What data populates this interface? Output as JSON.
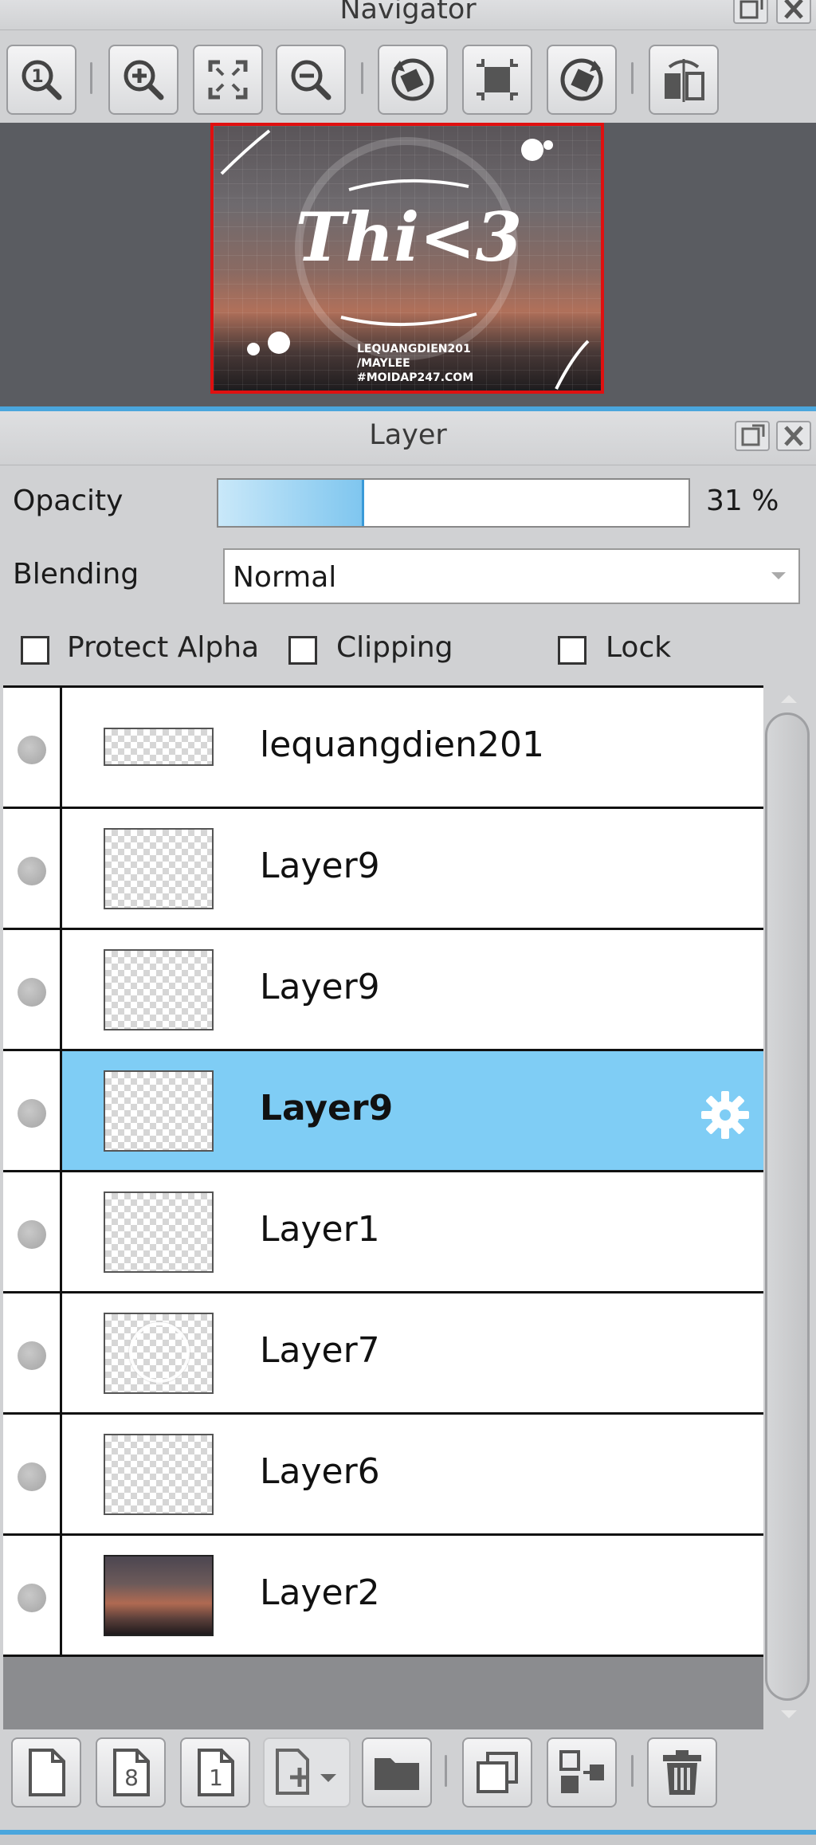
{
  "navigator": {
    "title": "Navigator",
    "toolbar_icons": [
      "zoom-actual-icon",
      "zoom-in-icon",
      "fit-window-icon",
      "zoom-out-icon",
      "rotate-left-icon",
      "rotate-reset-icon",
      "rotate-right-icon",
      "flip-icon"
    ],
    "preview_text": {
      "main": "Thi<3",
      "credits": [
        "LEQUANGDIEN201",
        "/MAYLEE",
        "#MOIDAP247.COM"
      ]
    }
  },
  "layer_panel": {
    "title": "Layer",
    "opacity_label": "Opacity",
    "opacity_value": 31,
    "opacity_text": "31 %",
    "blending_label": "Blending",
    "blending_value": "Normal",
    "checkboxes": [
      {
        "label": "Protect Alpha",
        "checked": false
      },
      {
        "label": "Clipping",
        "checked": false
      },
      {
        "label": "Lock",
        "checked": false
      }
    ],
    "layers": [
      {
        "name": "lequangdien201",
        "selected": false
      },
      {
        "name": "Layer9",
        "selected": false
      },
      {
        "name": "Layer9",
        "selected": false
      },
      {
        "name": "Layer9",
        "selected": true
      },
      {
        "name": "Layer1",
        "selected": false
      },
      {
        "name": "Layer7",
        "selected": false
      },
      {
        "name": "Layer6",
        "selected": false
      },
      {
        "name": "Layer2",
        "selected": false
      }
    ],
    "bottom_icons": [
      "new-layer-icon",
      "new-8bit-layer-icon",
      "new-1bit-layer-icon",
      "add-layer-menu-icon",
      "new-folder-icon",
      "duplicate-layer-icon",
      "merge-down-icon",
      "delete-layer-icon"
    ]
  },
  "colors": {
    "selection": "#7fcdf5",
    "accent_border": "#e01010",
    "panel_bg": "#c8c9cb",
    "canvas_bg": "#5a5c61"
  }
}
